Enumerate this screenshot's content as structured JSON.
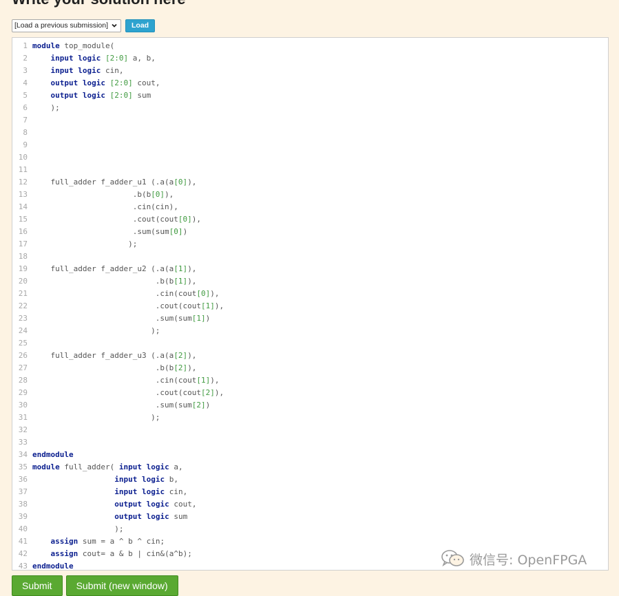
{
  "page": {
    "title": "Write your solution here"
  },
  "toolbar": {
    "select_value": "[Load a previous submission]",
    "load_label": "Load"
  },
  "editor": {
    "lines": [
      "[[\"kw\",\"module\"],[\"t\",\" top_module(\"]]",
      "[[\"t\",\"    \"],[\"kw\",\"input logic\"],[\"t\",\" \"],[\"num\",\"[2:0]\"],[\"t\",\" a, b,\"]]",
      "[[\"t\",\"    \"],[\"kw\",\"input logic\"],[\"t\",\" cin,\"]]",
      "[[\"t\",\"    \"],[\"kw\",\"output logic\"],[\"t\",\" \"],[\"num\",\"[2:0]\"],[\"t\",\" cout,\"]]",
      "[[\"t\",\"    \"],[\"kw\",\"output logic\"],[\"t\",\" \"],[\"num\",\"[2:0]\"],[\"t\",\" sum\"]]",
      "[[\"t\",\"    );\"]]",
      "[]",
      "[]",
      "[]",
      "[]",
      "[]",
      "[[\"t\",\"    full_adder f_adder_u1 (.a(a\"],[\"num\",\"[0]\"],[\"t\",\"),\"]]",
      "[[\"t\",\"                      .b(b\"],[\"num\",\"[0]\"],[\"t\",\"),\"]]",
      "[[\"t\",\"                      .cin(cin),\"]]",
      "[[\"t\",\"                      .cout(cout\"],[\"num\",\"[0]\"],[\"t\",\"),\"]]",
      "[[\"t\",\"                      .sum(sum\"],[\"num\",\"[0]\"],[\"t\",\")\"]]",
      "[[\"t\",\"                     );\"]]",
      "[]",
      "[[\"t\",\"    full_adder f_adder_u2 (.a(a\"],[\"num\",\"[1]\"],[\"t\",\"),\"]]",
      "[[\"t\",\"                           .b(b\"],[\"num\",\"[1]\"],[\"t\",\"),\"]]",
      "[[\"t\",\"                           .cin(cout\"],[\"num\",\"[0]\"],[\"t\",\"),\"]]",
      "[[\"t\",\"                           .cout(cout\"],[\"num\",\"[1]\"],[\"t\",\"),\"]]",
      "[[\"t\",\"                           .sum(sum\"],[\"num\",\"[1]\"],[\"t\",\")\"]]",
      "[[\"t\",\"                          );\"]]",
      "[]",
      "[[\"t\",\"    full_adder f_adder_u3 (.a(a\"],[\"num\",\"[2]\"],[\"t\",\"),\"]]",
      "[[\"t\",\"                           .b(b\"],[\"num\",\"[2]\"],[\"t\",\"),\"]]",
      "[[\"t\",\"                           .cin(cout\"],[\"num\",\"[1]\"],[\"t\",\"),\"]]",
      "[[\"t\",\"                           .cout(cout\"],[\"num\",\"[2]\"],[\"t\",\"),\"]]",
      "[[\"t\",\"                           .sum(sum\"],[\"num\",\"[2]\"],[\"t\",\")\"]]",
      "[[\"t\",\"                          );\"]]",
      "[]",
      "[]",
      "[[\"kw\",\"endmodule\"]]",
      "[[\"kw\",\"module\"],[\"t\",\" full_adder( \"],[\"kw\",\"input logic\"],[\"t\",\" a,\"]]",
      "[[\"t\",\"                  \"],[\"kw\",\"input logic\"],[\"t\",\" b,\"]]",
      "[[\"t\",\"                  \"],[\"kw\",\"input logic\"],[\"t\",\" cin,\"]]",
      "[[\"t\",\"                  \"],[\"kw\",\"output logic\"],[\"t\",\" cout,\"]]",
      "[[\"t\",\"                  \"],[\"kw\",\"output logic\"],[\"t\",\" sum\"]]",
      "[[\"t\",\"                  );\"]]",
      "[[\"t\",\"    \"],[\"kw\",\"assign\"],[\"t\",\" sum = a ^ b ^ cin;\"]]",
      "[[\"t\",\"    \"],[\"kw\",\"assign\"],[\"t\",\" cout= a & b | cin&(a^b);\"]]",
      "[[\"kw\",\"endmodule\"]]"
    ]
  },
  "watermark": {
    "text": "微信号: OpenFPGA",
    "icon": "wechat-logo-icon"
  },
  "buttons": {
    "submit_label": "Submit",
    "submit_new_window_label": "Submit (new window)"
  },
  "colors": {
    "page_bg": "#fdf3e3",
    "keyword": "#0b1f8f",
    "number": "#3f9a3f",
    "load_button": "#2ea3cf",
    "submit_button": "#5aa932"
  }
}
